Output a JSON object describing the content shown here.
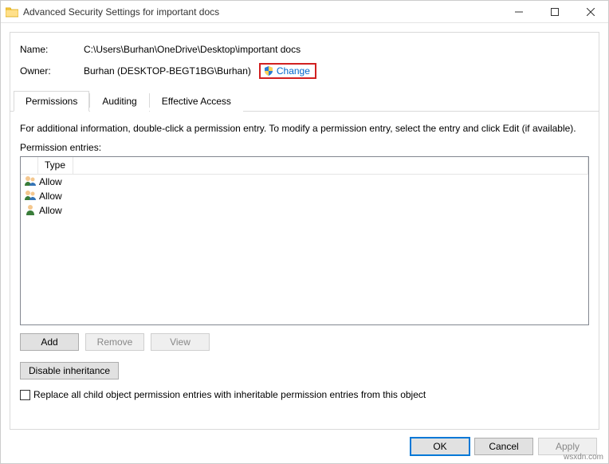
{
  "window": {
    "title": "Advanced Security Settings for important docs"
  },
  "info": {
    "name_label": "Name:",
    "name_value": "C:\\Users\\Burhan\\OneDrive\\Desktop\\important docs",
    "owner_label": "Owner:",
    "owner_value": "Burhan (DESKTOP-BEGT1BG\\Burhan)",
    "change_label": "Change"
  },
  "tabs": {
    "permissions": "Permissions",
    "auditing": "Auditing",
    "effective": "Effective Access"
  },
  "hint": "For additional information, double-click a permission entry. To modify a permission entry, select the entry and click Edit (if available).",
  "entries_label": "Permission entries:",
  "columns": {
    "type": "Type"
  },
  "entries": [
    {
      "type": "Allow",
      "icon": "group"
    },
    {
      "type": "Allow",
      "icon": "group"
    },
    {
      "type": "Allow",
      "icon": "user"
    }
  ],
  "buttons": {
    "add": "Add",
    "remove": "Remove",
    "view": "View",
    "disable_inherit": "Disable inheritance",
    "ok": "OK",
    "cancel": "Cancel",
    "apply": "Apply"
  },
  "checkbox": {
    "replace_label": "Replace all child object permission entries with inheritable permission entries from this object"
  },
  "watermark": "wsxdn.com"
}
